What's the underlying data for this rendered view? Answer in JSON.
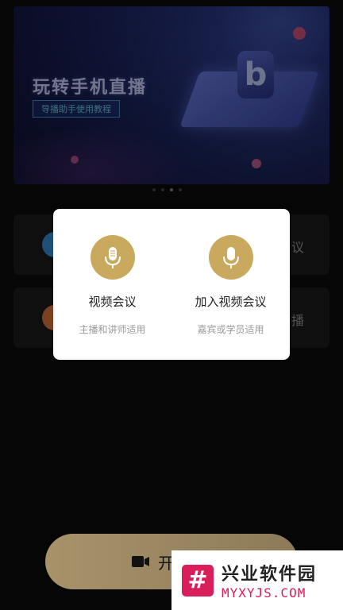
{
  "banner": {
    "title": "玩转手机直播",
    "subtitle": "导播助手使用教程",
    "logo_glyph": "b"
  },
  "carousel": {
    "count": 4,
    "active_index": 2
  },
  "cards": [
    {
      "right_text": "议"
    },
    {
      "right_text": "播"
    }
  ],
  "modal": {
    "options": [
      {
        "title": "视频会议",
        "subtitle": "主播和讲师适用",
        "icon": "microphone-icon"
      },
      {
        "title": "加入视频会议",
        "subtitle": "嘉宾或学员适用",
        "icon": "microphone-icon"
      }
    ]
  },
  "start_button": {
    "label": "开",
    "icon": "video-camera-icon"
  },
  "watermark": {
    "cn": "兴业软件园",
    "en": "MYXYJS.COM",
    "logo_glyph": "#"
  },
  "colors": {
    "accent_gold": "#c8a95e",
    "watermark_red": "#d81e5b"
  }
}
